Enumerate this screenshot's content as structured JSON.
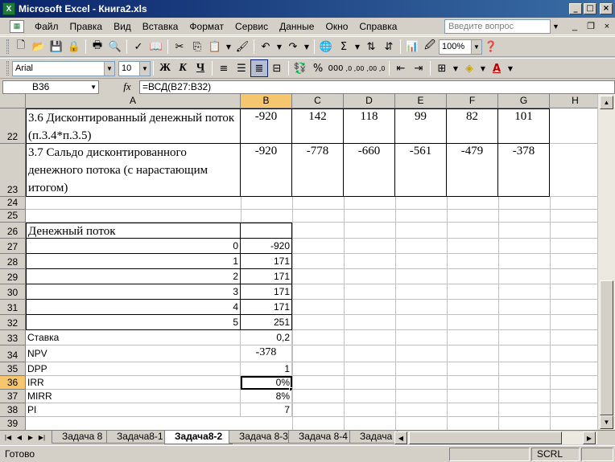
{
  "window": {
    "title": "Microsoft Excel - Книга2.xls",
    "controls": {
      "minimize": "_",
      "maximize": "□",
      "close": "×"
    }
  },
  "menu": {
    "items": [
      "Файл",
      "Правка",
      "Вид",
      "Вставка",
      "Формат",
      "Сервис",
      "Данные",
      "Окно",
      "Справка"
    ],
    "ask_placeholder": "Введите вопрос",
    "doc_controls": [
      "_",
      "❐",
      "×"
    ]
  },
  "toolbar": {
    "zoom": "100%",
    "font_name": "Arial",
    "font_size": "10",
    "bold": "Ж",
    "italic": "К",
    "underline": "Ч",
    "percent": "%",
    "thousands": "000",
    "dec_inc": ",0 ,00",
    "dec_dec": ",00 ,0",
    "sum": "Σ"
  },
  "formula_bar": {
    "name_box": "B36",
    "fx": "fx",
    "formula": "=ВСД(B27:B32)"
  },
  "columns": [
    "A",
    "B",
    "C",
    "D",
    "E",
    "F",
    "G",
    "H"
  ],
  "rows": {
    "r22": {
      "num": "22",
      "a": "3.6 Дисконтированный денежный поток (п.3.4*п.3.5)",
      "vals": [
        "-920",
        "142",
        "118",
        "99",
        "82",
        "101"
      ]
    },
    "r23": {
      "num": "23",
      "a": "3.7 Сальдо дисконтированного денежного потока (с нарастающим итогом)",
      "vals": [
        "-920",
        "-778",
        "-660",
        "-561",
        "-479",
        "-378"
      ]
    },
    "r24": {
      "num": "24"
    },
    "r25": {
      "num": "25"
    },
    "r26": {
      "num": "26",
      "a": "Денежный поток"
    },
    "r27": {
      "num": "27",
      "a": "0",
      "b": "-920"
    },
    "r28": {
      "num": "28",
      "a": "1",
      "b": "171"
    },
    "r29": {
      "num": "29",
      "a": "2",
      "b": "171"
    },
    "r30": {
      "num": "30",
      "a": "3",
      "b": "171"
    },
    "r31": {
      "num": "31",
      "a": "4",
      "b": "171"
    },
    "r32": {
      "num": "32",
      "a": "5",
      "b": "251"
    },
    "r33": {
      "num": "33",
      "a": "Ставка",
      "b": "0,2"
    },
    "r34": {
      "num": "34",
      "a": "NPV",
      "b": "-378"
    },
    "r35": {
      "num": "35",
      "a": "DPP",
      "b": "1"
    },
    "r36": {
      "num": "36",
      "a": "IRR",
      "b": "0%"
    },
    "r37": {
      "num": "37",
      "a": "MIRR",
      "b": "8%"
    },
    "r38": {
      "num": "38",
      "a": "PI",
      "b": "7"
    },
    "r39": {
      "num": "39"
    }
  },
  "sheet_tabs": [
    "Задача 8",
    "Задача8-1",
    "Задача8-2",
    "Задача 8-3",
    "Задача 8-4",
    "Задача"
  ],
  "active_tab": "Задача8-2",
  "status": {
    "ready": "Готово",
    "scrl": "SCRL"
  },
  "colors": {
    "title_start": "#0a246a",
    "title_end": "#3a6ea5",
    "selected_header": "#f5c66e"
  }
}
